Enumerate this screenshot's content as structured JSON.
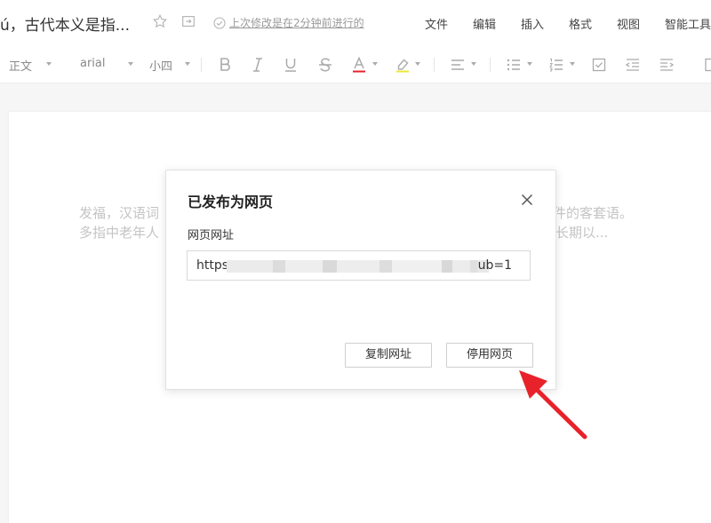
{
  "header": {
    "doc_title": "ú，古代本义是指...",
    "save_status": "上次修改是在2分钟前进行的",
    "menus": [
      "文件",
      "编辑",
      "插入",
      "格式",
      "视图",
      "智能工具"
    ]
  },
  "toolbar": {
    "style": "正文",
    "font": "arial",
    "size": "小四"
  },
  "document": {
    "line1_left": "发福，汉语词",
    "line1_right": "件的客套语。",
    "line2_left": "多指中老年人",
    "line2_right": "长期以..."
  },
  "dialog": {
    "title": "已发布为网页",
    "url_label": "网页网址",
    "url_prefix": "https",
    "url_suffix": "ub=1",
    "copy_button": "复制网址",
    "stop_button": "停用网页"
  },
  "colors": {
    "accent_arrow": "#e8222a",
    "muted_text": "#c4c4c4"
  }
}
